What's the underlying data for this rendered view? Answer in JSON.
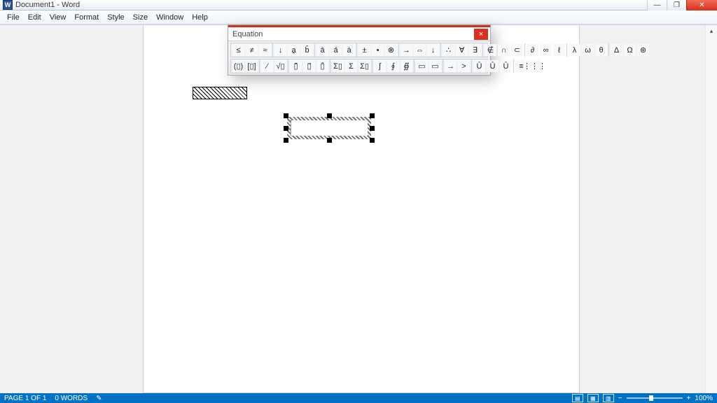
{
  "title": "Document1 - Word",
  "menu": [
    "File",
    "Edit",
    "View",
    "Format",
    "Style",
    "Size",
    "Window",
    "Help"
  ],
  "equation_dialog": {
    "title": "Equation",
    "row1": [
      [
        "≤",
        "≠",
        "≈"
      ],
      [
        "↓",
        "a̱",
        "b̂"
      ],
      [
        "ā",
        "á",
        "ȧ"
      ],
      [
        "±",
        "•",
        "⊗"
      ],
      [
        "→",
        "⇔",
        "↓"
      ],
      [
        "∴",
        "∀",
        "∃"
      ],
      [
        "∉",
        "∩",
        "⊂"
      ],
      [
        "∂",
        "∞",
        "ℓ"
      ],
      [
        "λ",
        "ω",
        "θ"
      ],
      [
        "Δ",
        "Ω",
        "⊛"
      ]
    ],
    "row2": [
      [
        "(▯)",
        "[▯]"
      ],
      [
        "⁄",
        "√▯"
      ],
      [
        "▯̄",
        "▯⃗",
        "▯̂"
      ],
      [
        "Σ▯",
        "Σ",
        "Σ▯"
      ],
      [
        "∫",
        "∮",
        "∯"
      ],
      [
        "▭",
        "▭"
      ],
      [
        "→",
        ">"
      ],
      [
        "Û",
        "Û",
        "Û"
      ],
      [
        "≡",
        "⋮⋮⋮"
      ]
    ]
  },
  "status": {
    "page": "PAGE 1 OF 1",
    "words": "0 WORDS",
    "zoom": "100%"
  }
}
